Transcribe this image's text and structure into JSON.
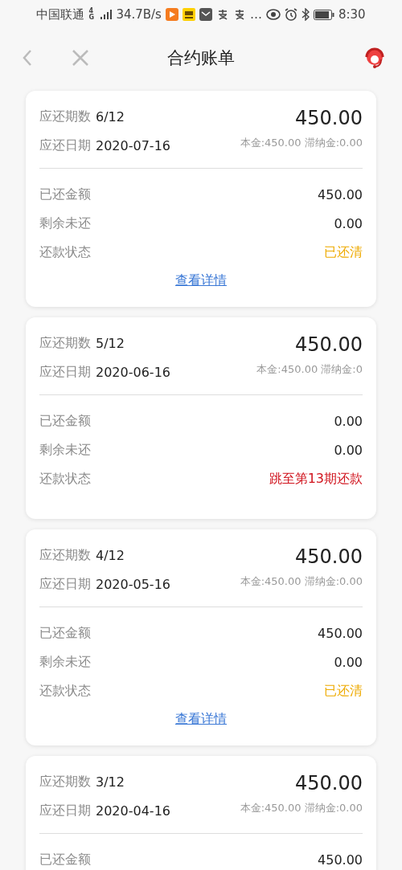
{
  "status_bar": {
    "carrier": "中国联通",
    "network": "4G",
    "speed": "34.7B/s",
    "more": "…",
    "time": "8:30"
  },
  "header": {
    "title": "合约账单"
  },
  "bills": [
    {
      "period_label": "应还期数",
      "period": "6/12",
      "date_label": "应还日期",
      "date": "2020-07-16",
      "amount": "450.00",
      "breakdown": "本金:450.00 滞纳金:0.00",
      "rows": [
        {
          "label": "已还金额",
          "value": "450.00",
          "kind": "plain"
        },
        {
          "label": "剩余未还",
          "value": "0.00",
          "kind": "plain"
        },
        {
          "label": "还款状态",
          "value": "已还清",
          "kind": "cleared"
        }
      ],
      "link": "查看详情"
    },
    {
      "period_label": "应还期数",
      "period": "5/12",
      "date_label": "应还日期",
      "date": "2020-06-16",
      "amount": "450.00",
      "breakdown": "本金:450.00 滞纳金:0",
      "rows": [
        {
          "label": "已还金额",
          "value": "0.00",
          "kind": "plain"
        },
        {
          "label": "剩余未还",
          "value": "0.00",
          "kind": "plain"
        },
        {
          "label": "还款状态",
          "value": "跳至第13期还款",
          "kind": "skipped"
        }
      ]
    },
    {
      "period_label": "应还期数",
      "period": "4/12",
      "date_label": "应还日期",
      "date": "2020-05-16",
      "amount": "450.00",
      "breakdown": "本金:450.00 滞纳金:0.00",
      "rows": [
        {
          "label": "已还金额",
          "value": "450.00",
          "kind": "plain"
        },
        {
          "label": "剩余未还",
          "value": "0.00",
          "kind": "plain"
        },
        {
          "label": "还款状态",
          "value": "已还清",
          "kind": "cleared"
        }
      ],
      "link": "查看详情"
    },
    {
      "period_label": "应还期数",
      "period": "3/12",
      "date_label": "应还日期",
      "date": "2020-04-16",
      "amount": "450.00",
      "breakdown": "本金:450.00 滞纳金:0.00",
      "rows": [
        {
          "label": "已还金额",
          "value": "450.00",
          "kind": "plain"
        }
      ]
    }
  ]
}
